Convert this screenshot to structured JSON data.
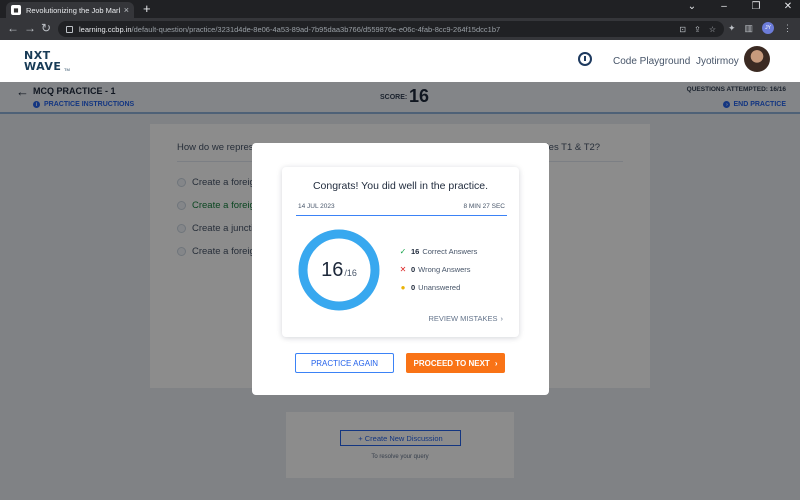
{
  "browser": {
    "tab_title": "Revolutionizing the Job Market |",
    "tab_close": "×",
    "new_tab": "+",
    "url_domain": "learning.ccbp.in",
    "url_path": "/default-question/practice/3231d4de-8e06-4a53-89ad-7b95daa3b766/d559876e-e06c-4fab-8cc9-264f15dcc1b7",
    "profile_initials": "JY"
  },
  "header": {
    "logo_line1": "NXT",
    "logo_line2": "WAVE",
    "logo_tm": "TM",
    "code_playground": "Code Playground",
    "user_name": "Jyotirmoy"
  },
  "practice_bar": {
    "title": "MCQ PRACTICE - 1",
    "instructions": "PRACTICE INSTRUCTIONS",
    "score_label": "SCORE:",
    "score_value": "16",
    "questions_attempted": "QUESTIONS ATTEMPTED: 16/16",
    "end_practice": "END PRACTICE"
  },
  "question": {
    "text_start": "How do we repres",
    "text_end": "ables T1 & T2?",
    "options": [
      {
        "label": "Create a foreig",
        "state": "normal"
      },
      {
        "label": "Create a foreig",
        "state": "correct"
      },
      {
        "label": "Create a juncti",
        "state": "normal"
      },
      {
        "label": "Create a foreig",
        "state": "normal"
      }
    ]
  },
  "discussion": {
    "button": "+ Create New Discussion",
    "hint": "To resolve your query"
  },
  "modal": {
    "congrats": "Congrats! You did well in the practice.",
    "date": "14 JUL 2023",
    "duration": "8 MIN 27 SEC",
    "score": "16",
    "total": "/16",
    "correct_count": "16",
    "correct_label": "Correct Answers",
    "wrong_count": "0",
    "wrong_label": "Wrong Answers",
    "unanswered_count": "0",
    "unanswered_label": "Unanswered",
    "review_mistakes": "REVIEW MISTAKES",
    "practice_again": "PRACTICE AGAIN",
    "proceed_next": "PROCEED TO NEXT",
    "score_fraction": 1.0
  },
  "colors": {
    "ring": "#38a8ef",
    "correct": "#16a34a",
    "wrong": "#dc2626",
    "unanswered": "#eab308",
    "primary_button": "#f97316",
    "link_blue": "#2563eb"
  },
  "icons": {
    "back": "arrow-left-icon",
    "info": "info-icon",
    "timer": "timer-icon",
    "chevron": "chevron-right-icon",
    "check": "check-icon",
    "cross": "cross-icon",
    "dot": "dot-icon"
  }
}
